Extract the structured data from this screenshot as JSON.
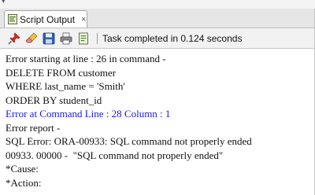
{
  "tab": {
    "label": "Script Output",
    "close_glyph": "×"
  },
  "toolbar": {
    "buttons": [
      {
        "name": "pin-icon"
      },
      {
        "name": "eraser-icon"
      },
      {
        "name": "save-icon"
      },
      {
        "name": "print-icon"
      },
      {
        "name": "document-icon"
      }
    ],
    "status": "Task completed in 0.124 seconds"
  },
  "output": {
    "lines": [
      {
        "text": "Error starting at line : 26 in command -",
        "color": "#111111"
      },
      {
        "text": "DELETE FROM customer",
        "color": "#111111"
      },
      {
        "text": "WHERE last_name = 'Smith'",
        "color": "#111111"
      },
      {
        "text": "ORDER BY student_id",
        "color": "#111111"
      },
      {
        "text": "Error at Command Line : 28 Column : 1",
        "color": "#1a1adb"
      },
      {
        "text": "Error report -",
        "color": "#111111"
      },
      {
        "text": "SQL Error: ORA-00933: SQL command not properly ended",
        "color": "#111111"
      },
      {
        "text": "00933. 00000 -  \"SQL command not properly ended\"",
        "color": "#111111"
      },
      {
        "text": "*Cause:",
        "color": "#111111"
      },
      {
        "text": "*Action:",
        "color": "#111111"
      }
    ]
  }
}
